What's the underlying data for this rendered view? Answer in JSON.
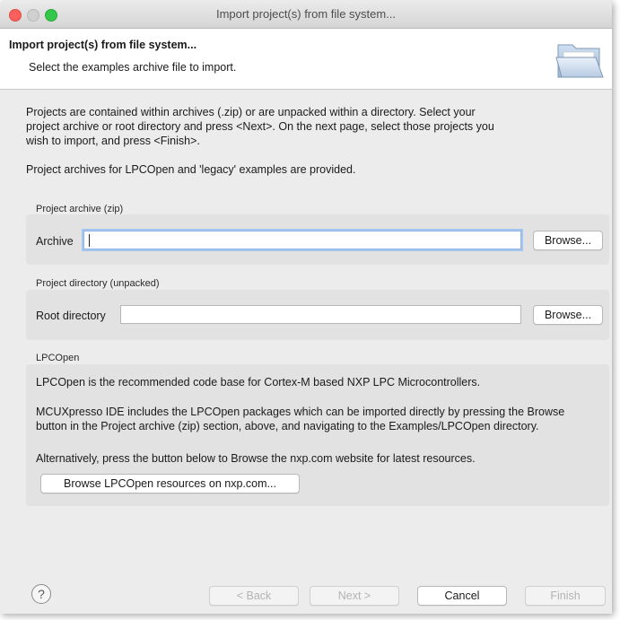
{
  "window": {
    "title": "Import project(s) from file system..."
  },
  "banner": {
    "title": "Import project(s) from file system...",
    "description": "Select the examples archive file to import."
  },
  "intro": {
    "line1": "Projects are contained within archives (.zip) or are unpacked within a directory. Select your",
    "line2": "project archive or root directory and press <Next>. On the next page, select those projects you",
    "line3": "wish to import, and press <Finish>.",
    "legacy": "Project archives for LPCOpen and 'legacy' examples are provided."
  },
  "archive_group": {
    "label": "Project archive (zip)",
    "field_label": "Archive",
    "value": "",
    "browse_label": "Browse..."
  },
  "directory_group": {
    "label": "Project directory (unpacked)",
    "field_label": "Root directory",
    "value": "",
    "browse_label": "Browse..."
  },
  "lpcopen_group": {
    "label": "LPCOpen",
    "text1": "LPCOpen is the recommended code base for Cortex-M based NXP LPC Microcontrollers.",
    "text2_line1": "MCUXpresso IDE includes the LPCOpen packages which can be imported directly by pressing the Browse",
    "text2_line2": "button in the Project archive (zip) section, above, and navigating to the Examples/LPCOpen directory.",
    "text3": "Alternatively, press the button below to Browse the nxp.com website for latest resources.",
    "button_label": "Browse LPCOpen resources on nxp.com..."
  },
  "footer": {
    "help_glyph": "?",
    "back_label": "< Back",
    "next_label": "Next >",
    "cancel_label": "Cancel",
    "finish_label": "Finish"
  },
  "icons": [
    "folder-open-icon",
    "help-icon"
  ],
  "colors": {
    "close": "#fc605c",
    "maximize": "#34c84a",
    "focus_ring": "#a7c6ef",
    "window_bg": "#ececec",
    "group_bg": "#e2e2e2"
  }
}
